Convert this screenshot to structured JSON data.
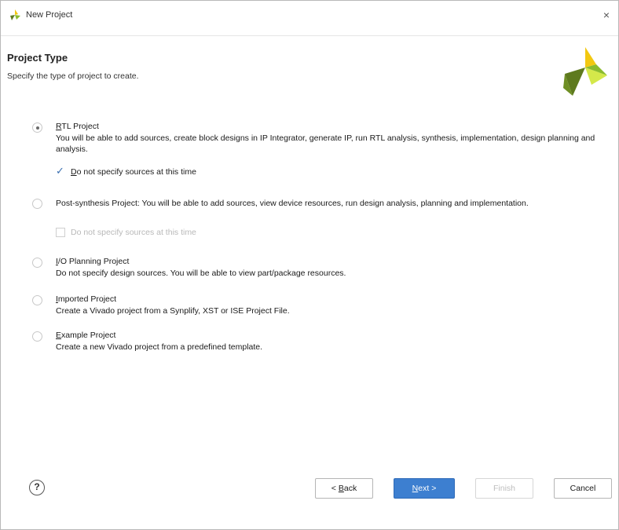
{
  "window": {
    "title": "New Project",
    "close_glyph": "×",
    "icon": "vivado-logo-icon"
  },
  "header": {
    "title": "Project Type",
    "subtitle": "Specify the type of project to create.",
    "logo": "vivado-brand-logo",
    "colors": {
      "logo_yellow": "#f2c811",
      "logo_green": "#8bbb2e",
      "logo_light": "#d4e84a",
      "logo_dark": "#5e7a1e"
    }
  },
  "options": [
    {
      "accel": "R",
      "rest": "TL Project",
      "selected": true,
      "description": "You will be able to add sources, create block designs in IP Integrator, generate IP, run RTL analysis, synthesis, implementation, design planning and analysis.",
      "checkbox": {
        "accel": "D",
        "rest": "o not specify sources at this time",
        "checked": true,
        "enabled": true
      }
    },
    {
      "accel": "P",
      "rest": "ost-synthesis Project:",
      "selected": false,
      "description": "You will be able to add sources, view device resources, run design analysis, planning and implementation.",
      "checkbox": {
        "label": "Do not specify sources at this time",
        "checked": false,
        "enabled": false
      }
    },
    {
      "accel": "I",
      "rest": "/O Planning Project",
      "selected": false,
      "description": "Do not specify design sources. You will be able to view part/package resources."
    },
    {
      "accel": "I",
      "rest": "mported Project",
      "selected": false,
      "description": "Create a Vivado project from a Synplify, XST or ISE Project File."
    },
    {
      "accel": "E",
      "rest": "xample Project",
      "selected": false,
      "description": "Create a new Vivado project from a predefined template."
    }
  ],
  "footer": {
    "help_glyph": "?",
    "back_prefix": "< ",
    "back_accel": "B",
    "back_rest": "ack",
    "next_accel": "N",
    "next_rest": "ext >",
    "finish_label": "Finish",
    "cancel_label": "Cancel",
    "colors": {
      "primary": "#3d7fd0"
    }
  }
}
